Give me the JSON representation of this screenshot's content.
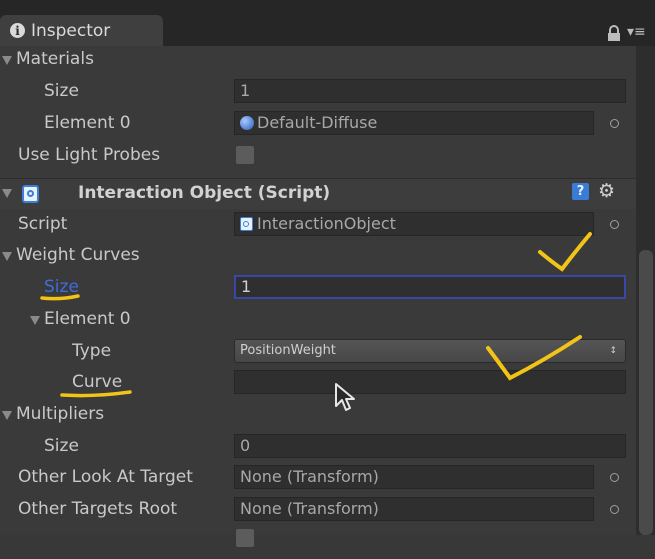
{
  "window": {
    "tab_title": "Inspector"
  },
  "icons": {
    "info": "i",
    "lock": "lock-icon",
    "menu": "▾≡",
    "help": "?",
    "gear": "⚙",
    "popup_arrow": "↕",
    "material_sphere": "sphere-icon",
    "script": "script-icon"
  },
  "materials": {
    "header": "Materials",
    "size_label": "Size",
    "size_value": "1",
    "element0_label": "Element 0",
    "element0_value": "Default-Diffuse"
  },
  "light_probes": {
    "label": "Use Light Probes",
    "checked": false
  },
  "component": {
    "title": "Interaction Object (Script)",
    "script_label": "Script",
    "script_value": "InteractionObject"
  },
  "weight_curves": {
    "header": "Weight Curves",
    "size_label": "Size",
    "size_value": "1",
    "element0_label": "Element 0",
    "type_label": "Type",
    "type_value": "PositionWeight",
    "curve_label": "Curve",
    "curve_value": ""
  },
  "multipliers": {
    "header": "Multipliers",
    "size_label": "Size",
    "size_value": "0"
  },
  "other_look_at_target": {
    "label": "Other Look At Target",
    "value": "None (Transform)"
  },
  "other_targets_root": {
    "label": "Other Targets Root",
    "value": "None (Transform)"
  },
  "colors": {
    "background": "#383838",
    "text": "#c9c9c9",
    "highlight_label": "#3d6de0",
    "annotation": "#f2c417",
    "focus_border": "#3a47a8"
  }
}
